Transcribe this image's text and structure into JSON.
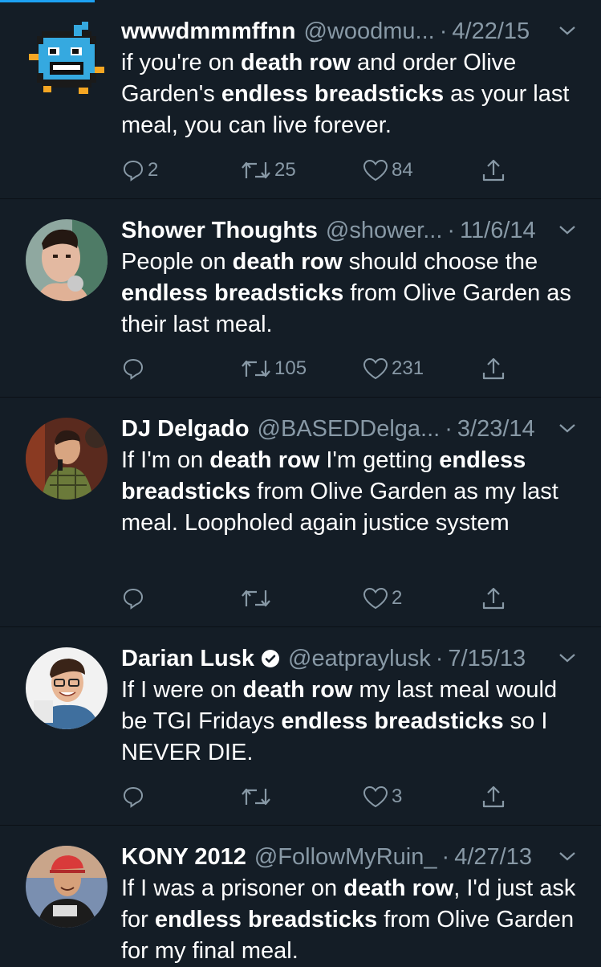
{
  "tweets": [
    {
      "name": "wwwdmmmffnn",
      "handle": "@woodmu...",
      "date": "4/22/15",
      "verified": false,
      "body": [
        {
          "t": "if you're on "
        },
        {
          "t": "death row",
          "b": true
        },
        {
          "t": " and order Olive Garden's "
        },
        {
          "t": "endless breadsticks",
          "b": true
        },
        {
          "t": " as your last meal, you can live forever."
        }
      ],
      "replies": "2",
      "retweets": "25",
      "likes": "84"
    },
    {
      "name": "Shower Thoughts",
      "handle": "@shower...",
      "date": "11/6/14",
      "verified": false,
      "body": [
        {
          "t": "People on "
        },
        {
          "t": "death row",
          "b": true
        },
        {
          "t": " should choose the "
        },
        {
          "t": "endless breadsticks",
          "b": true
        },
        {
          "t": " from Olive Garden as their last meal."
        }
      ],
      "replies": "",
      "retweets": "105",
      "likes": "231"
    },
    {
      "name": "DJ Delgado",
      "handle": "@BASEDDelga...",
      "date": "3/23/14",
      "verified": false,
      "body": [
        {
          "t": "If I'm on "
        },
        {
          "t": "death row",
          "b": true
        },
        {
          "t": " I'm getting "
        },
        {
          "t": "endless breadsticks",
          "b": true
        },
        {
          "t": " from Olive Garden as my last meal. Loopholed again justice system"
        }
      ],
      "replies": "",
      "retweets": "",
      "likes": "2"
    },
    {
      "name": "Darian Lusk",
      "handle": "@eatpraylusk",
      "date": "7/15/13",
      "verified": true,
      "body": [
        {
          "t": "If I were on "
        },
        {
          "t": "death row",
          "b": true
        },
        {
          "t": " my last meal would be TGI Fridays "
        },
        {
          "t": "endless breadsticks",
          "b": true
        },
        {
          "t": " so I NEVER DIE."
        }
      ],
      "replies": "",
      "retweets": "",
      "likes": "3"
    },
    {
      "name": "KONY 2012",
      "handle": "@FollowMyRuin_",
      "date": "4/27/13",
      "verified": false,
      "body": [
        {
          "t": "If I was a prisoner on "
        },
        {
          "t": "death row",
          "b": true
        },
        {
          "t": ", I'd just ask for "
        },
        {
          "t": "endless breadsticks",
          "b": true
        },
        {
          "t": " from Olive Garden for my final meal."
        }
      ],
      "replies": "",
      "retweets": "",
      "likes": ""
    }
  ],
  "icons": {
    "reply": "reply-icon",
    "retweet": "retweet-icon",
    "like": "heart-icon",
    "share": "share-icon",
    "more": "chevron-down-icon",
    "verified": "verified-badge-icon"
  },
  "colors": {
    "background": "#141d26",
    "text": "#ffffff",
    "muted": "#8899a6",
    "accent": "#1da1f2"
  }
}
